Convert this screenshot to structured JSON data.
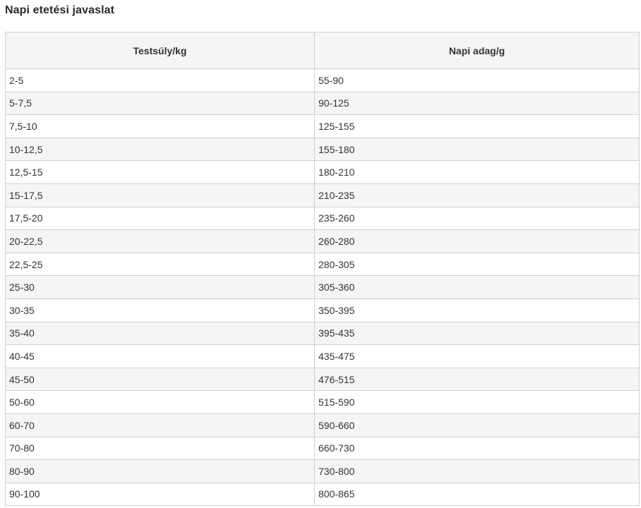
{
  "title": "Napi etetési javaslat",
  "table": {
    "headers": [
      "Testsúly/kg",
      "Napi adag/g"
    ],
    "rows": [
      [
        "2-5",
        "55-90"
      ],
      [
        "5-7,5",
        "90-125"
      ],
      [
        "7,5-10",
        "125-155"
      ],
      [
        "10-12,5",
        "155-180"
      ],
      [
        "12,5-15",
        "180-210"
      ],
      [
        "15-17,5",
        "210-235"
      ],
      [
        "17,5-20",
        "235-260"
      ],
      [
        "20-22,5",
        "260-280"
      ],
      [
        "22,5-25",
        "280-305"
      ],
      [
        "25-30",
        "305-360"
      ],
      [
        "30-35",
        "350-395"
      ],
      [
        "35-40",
        "395-435"
      ],
      [
        "40-45",
        "435-475"
      ],
      [
        "45-50",
        "476-515"
      ],
      [
        "50-60",
        "515-590"
      ],
      [
        "60-70",
        "590-660"
      ],
      [
        "70-80",
        "660-730"
      ],
      [
        "80-90",
        "730-800"
      ],
      [
        "90-100",
        "800-865"
      ]
    ]
  }
}
